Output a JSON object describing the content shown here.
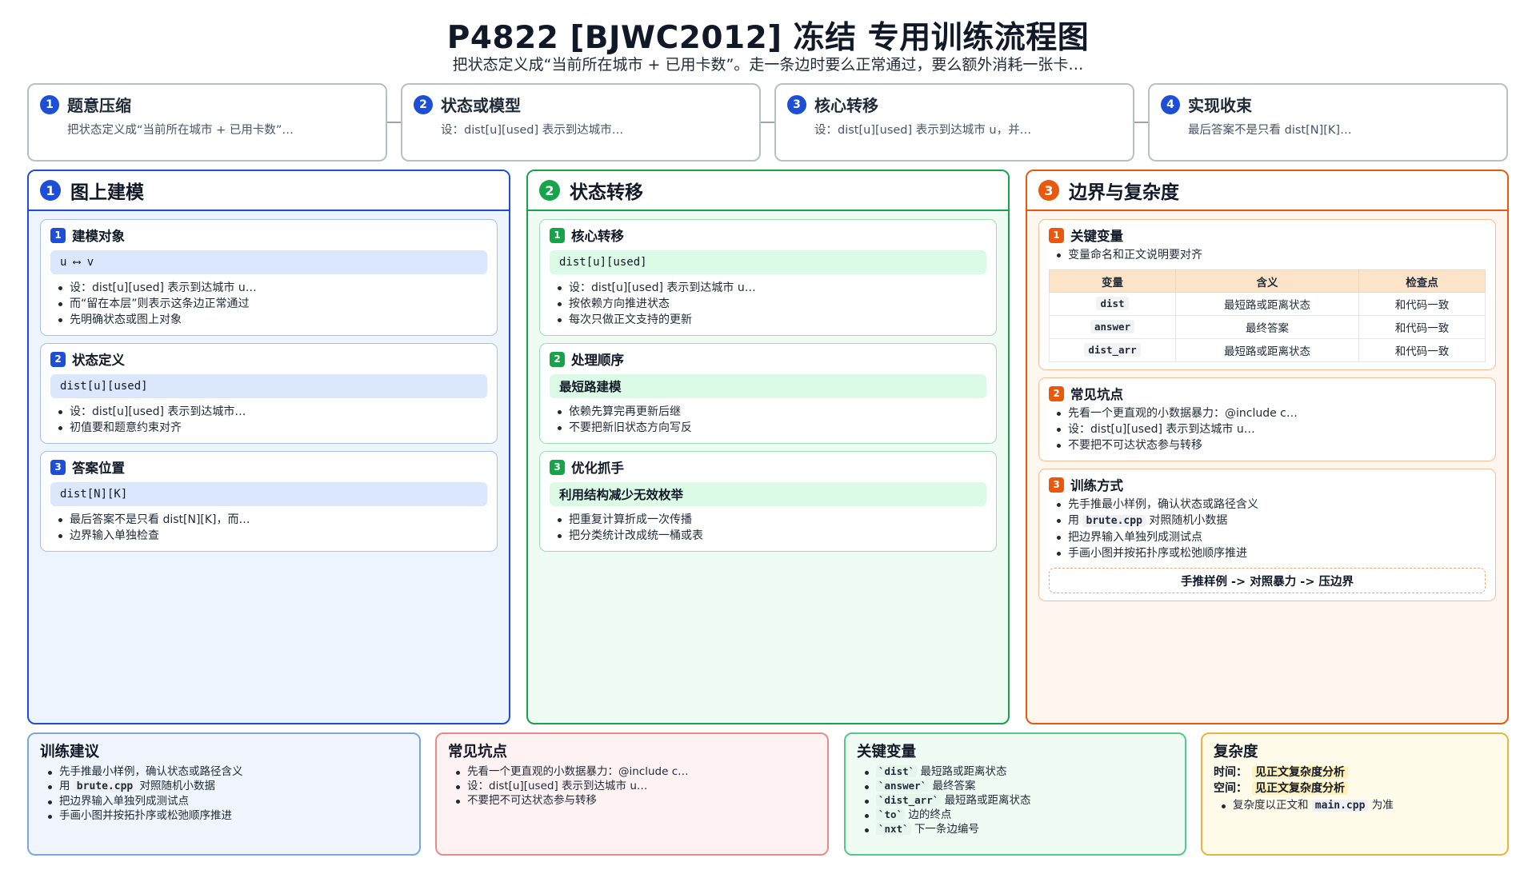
{
  "title": "P4822 [BJWC2012] 冻结 专用训练流程图",
  "subtitle": "把状态定义成“当前所在城市 + 已用卡数”。走一条边时要么正常通过，要么额外消耗一张卡…",
  "colors": {
    "blue": "#1d4ed8",
    "green": "#16a34a",
    "orange": "#ea580c",
    "red": "#ec8a8a",
    "yellow": "#e8b640"
  },
  "steps": [
    {
      "num": "1",
      "title": "题意压缩",
      "desc": "把状态定义成“当前所在城市 + 已用卡数”…"
    },
    {
      "num": "2",
      "title": "状态或模型",
      "desc": "设：dist[u][used] 表示到达城市…"
    },
    {
      "num": "3",
      "title": "核心转移",
      "desc": "设：dist[u][used] 表示到达城市 u，并…"
    },
    {
      "num": "4",
      "title": "实现收束",
      "desc": "最后答案不是只看 dist[N][K]…"
    }
  ],
  "columns": {
    "left": {
      "num": "1",
      "title": "图上建模",
      "cards": [
        {
          "num": "1",
          "title": "建模对象",
          "chip": "u ⟷ v",
          "bullets": [
            "设：dist[u][used] 表示到达城市 u…",
            "而“留在本层”则表示这条边正常通过",
            "先明确状态或图上对象"
          ]
        },
        {
          "num": "2",
          "title": "状态定义",
          "chip": "dist[u][used]",
          "bullets": [
            "设：dist[u][used] 表示到达城市…",
            "初值要和题意约束对齐"
          ]
        },
        {
          "num": "3",
          "title": "答案位置",
          "chip": "dist[N][K]",
          "bullets": [
            "最后答案不是只看 dist[N][K]，而…",
            "边界输入单独检查"
          ]
        }
      ]
    },
    "middle": {
      "num": "2",
      "title": "状态转移",
      "cards": [
        {
          "num": "1",
          "title": "核心转移",
          "chip": "dist[u][used]",
          "bullets": [
            "设：dist[u][used] 表示到达城市 u…",
            "按依赖方向推进状态",
            "每次只做正文支持的更新"
          ]
        },
        {
          "num": "2",
          "title": "处理顺序",
          "chip": "最短路建模",
          "bullets": [
            "依赖先算完再更新后继",
            "不要把新旧状态方向写反"
          ]
        },
        {
          "num": "3",
          "title": "优化抓手",
          "chip": "利用结构减少无效枚举",
          "bullets": [
            "把重复计算折成一次传播",
            "把分类统计改成统一桶或表"
          ]
        }
      ]
    },
    "right": {
      "num": "3",
      "title": "边界与复杂度",
      "vars_card": {
        "num": "1",
        "title": "关键变量",
        "note": "变量命名和正文说明要对齐",
        "headers": [
          "变量",
          "含义",
          "检查点"
        ],
        "rows": [
          [
            "dist",
            "最短路或距离状态",
            "和代码一致"
          ],
          [
            "answer",
            "最终答案",
            "和代码一致"
          ],
          [
            "dist_arr",
            "最短路或距离状态",
            "和代码一致"
          ]
        ]
      },
      "pit_card": {
        "num": "2",
        "title": "常见坑点",
        "bullets": [
          "先看一个更直观的小数据暴力：@include c…",
          "设：dist[u][used] 表示到达城市 u…",
          "不要把不可达状态参与转移"
        ]
      },
      "train_card": {
        "num": "3",
        "title": "训练方式",
        "b1": "先手推最小样例，确认状态或路径含义",
        "b2_pre": "用",
        "b2_code": "brute.cpp",
        "b2_post": "对照随机小数据",
        "b3": "把边界输入单独列成测试点",
        "b4": "手画小图并按拓扑序或松弛顺序推进",
        "flow": "手推样例 -> 对照暴力 -> 压边界"
      }
    }
  },
  "bottom": {
    "advice": {
      "title": "训练建议",
      "b1": "先手推最小样例，确认状态或路径含义",
      "b2_pre": "用",
      "b2_code": "brute.cpp",
      "b2_post": "对照随机小数据",
      "b3": "把边界输入单独列成测试点",
      "b4": "手画小图并按拓扑序或松弛顺序推进"
    },
    "pitfalls": {
      "title": "常见坑点",
      "bullets": [
        "先看一个更直观的小数据暴力：@include c…",
        "设：dist[u][used] 表示到达城市 u…",
        "不要把不可达状态参与转移"
      ]
    },
    "keyvars": {
      "title": "关键变量",
      "items": [
        {
          "code": "`dist`",
          "text": "最短路或距离状态"
        },
        {
          "code": "`answer`",
          "text": "最终答案"
        },
        {
          "code": "`dist_arr`",
          "text": "最短路或距离状态"
        },
        {
          "code": "`to`",
          "text": "边的终点"
        },
        {
          "code": "`nxt`",
          "text": "下一条边编号"
        }
      ]
    },
    "complexity": {
      "title": "复杂度",
      "time_label": "时间：",
      "time_value": "见正文复杂度分析",
      "space_label": "空间：",
      "space_value": "见正文复杂度分析",
      "note_pre": "复杂度以正文和",
      "note_code": "main.cpp",
      "note_post": "为准"
    }
  }
}
